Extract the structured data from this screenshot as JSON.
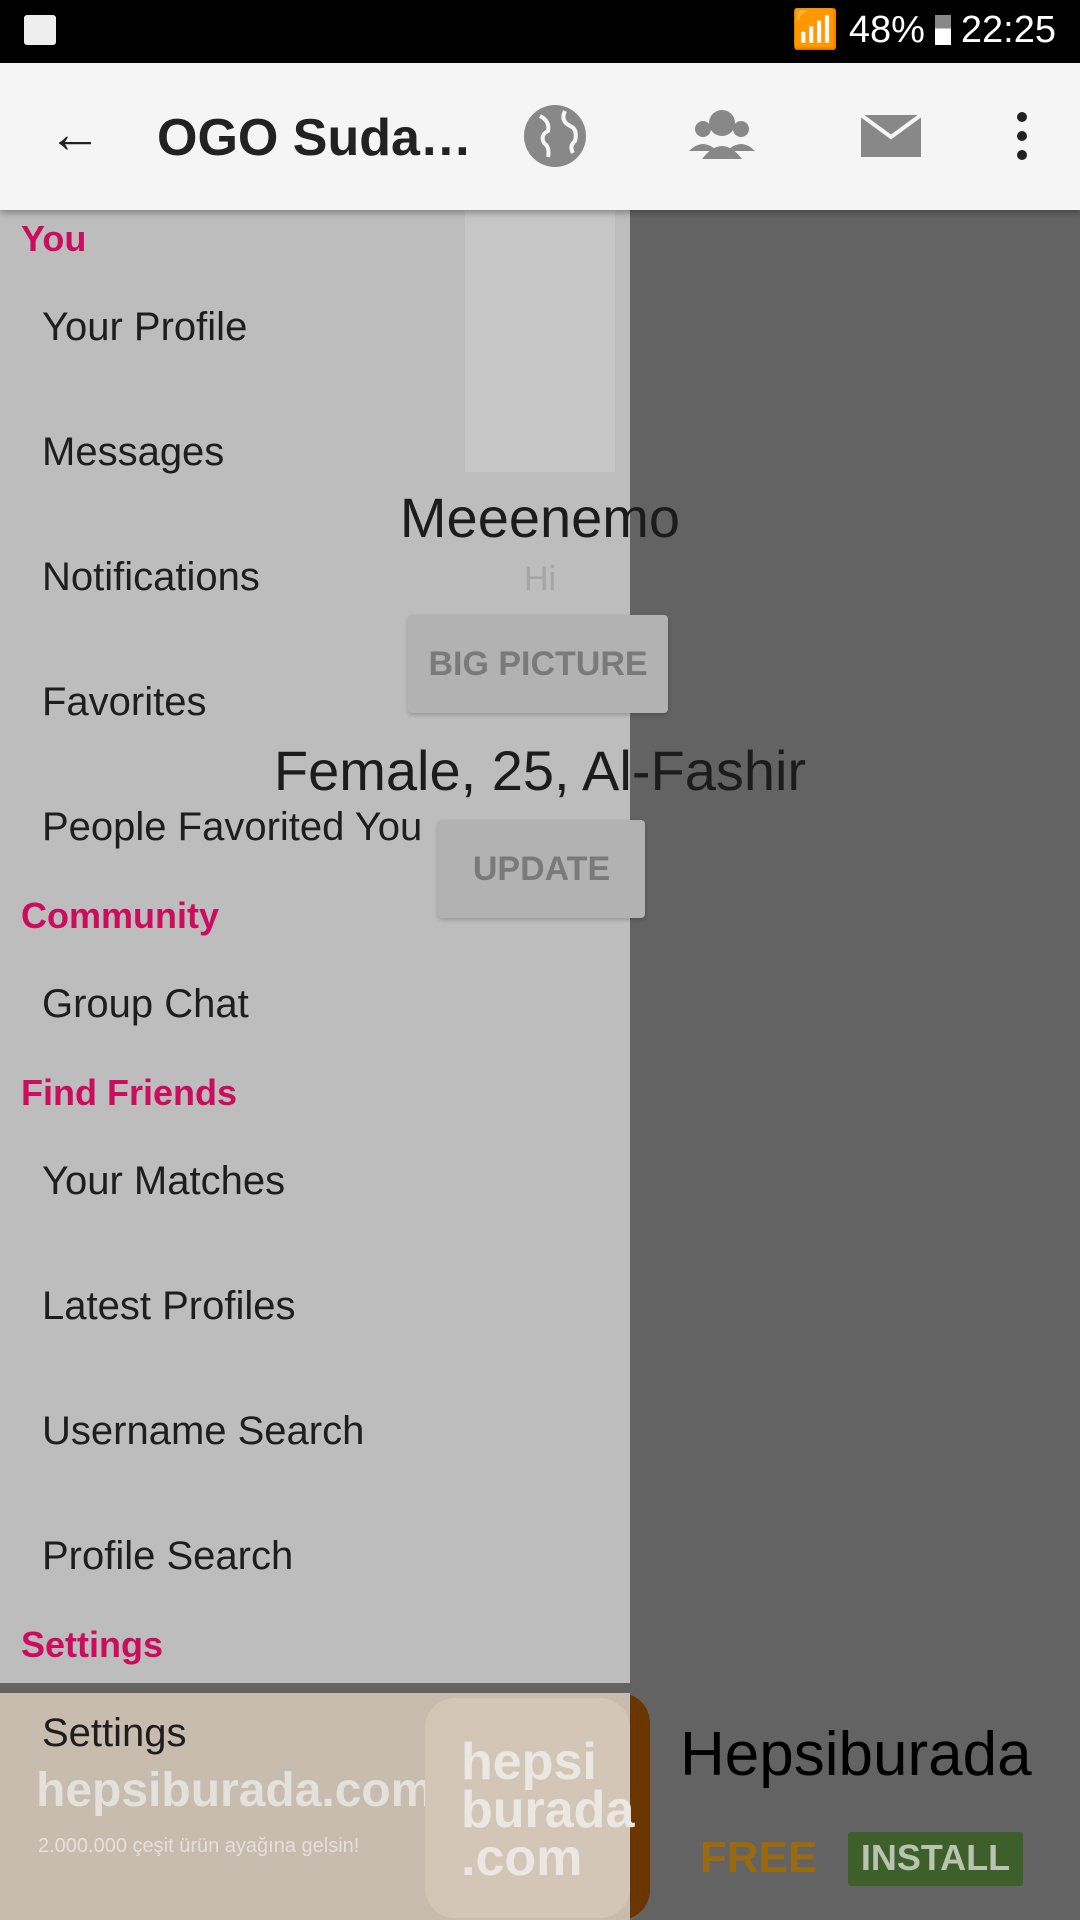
{
  "status": {
    "battery": "48%",
    "time": "22:25"
  },
  "appbar": {
    "title": "OGO Suda…",
    "icons": [
      "globe-icon",
      "group-icon",
      "mail-icon",
      "more-vert-icon"
    ]
  },
  "profile": {
    "name": "Meeenemo",
    "status": "Hi",
    "big_picture": "BIG PICTURE",
    "info": "Female, 25, Al-Fashir",
    "update": "UPDATE"
  },
  "ad": {
    "image_title": "hepsiburada.com",
    "image_tagline": "2.000.000 çeşit ürün ayağına gelsin!",
    "logo": "hepsi burada .com",
    "name": "Hepsiburada",
    "price": "FREE",
    "install": "INSTALL"
  },
  "drawer": {
    "sections": [
      {
        "header": "You",
        "items": [
          "Your Profile",
          "Messages",
          "Notifications",
          "Favorites",
          "People Favorited You"
        ]
      },
      {
        "header": "Community",
        "items": [
          "Group Chat"
        ]
      },
      {
        "header": "Find Friends",
        "items": [
          "Your Matches",
          "Latest Profiles",
          "Username Search",
          "Profile Search"
        ]
      },
      {
        "header": "Settings",
        "items": [
          "Settings"
        ]
      }
    ]
  },
  "colors": {
    "section_header": "#cc0c5c",
    "install": "#4f8f2c",
    "free": "#e69500"
  }
}
